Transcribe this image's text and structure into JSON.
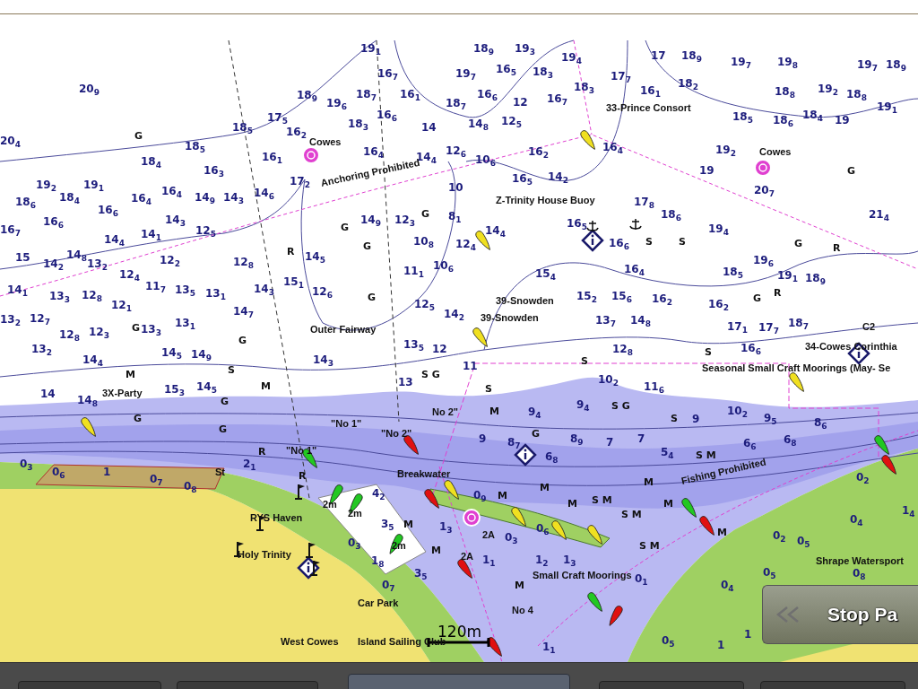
{
  "chart": {
    "place_names": [
      "Cowes",
      "33-Prince Consort",
      "Cowes",
      "Anchoring Prohibited",
      "Z-Trinity House Buoy",
      "39-Snowden",
      "39-Snowden",
      "Outer Fairway",
      "C2",
      "34-Cowes Corinthia",
      "Seasonal Small Craft Moorings (May- Se",
      "3X-Party",
      "No 2\"",
      "\"No 1\"",
      "\"No 2\"",
      "\"No 1\"",
      "St",
      "Breakwater",
      "Fishing Prohibited",
      "2m",
      "2m",
      "2m",
      "RYS Haven",
      "Holy Trinity",
      "2A",
      "2A",
      "Small Craft Moorings",
      "Car Park",
      "No 4",
      "Shrape Watersport",
      "West Cowes",
      "Island Sailing Club"
    ],
    "seabed_codes": [
      "G",
      "G",
      "G",
      "R",
      "G",
      "G",
      "G",
      "G",
      "M",
      "S",
      "S G",
      "M",
      "G",
      "G",
      "S",
      "M",
      "G",
      "R",
      "R",
      "S",
      "S",
      "G",
      "G",
      "R",
      "G",
      "R",
      "S",
      "S",
      "S G",
      "S",
      "S M",
      "G",
      "M",
      "M",
      "S M",
      "S M",
      "S M",
      "M",
      "M",
      "M",
      "M",
      "M",
      "M",
      "M"
    ],
    "soundings": [
      "19$_{1}$",
      "18$_{9}$",
      "19$_{3}$",
      "19$_{4}$",
      "17",
      "18$_{9}$",
      "19$_{7}$",
      "19$_{8}$",
      "19$_{7}$",
      "18$_{9}$",
      "20$_{9}$",
      "16$_{7}$",
      "19$_{7}$",
      "16$_{5}$",
      "18$_{3}$",
      "17$_{7}$",
      "18$_{3}$",
      "16$_{1}$",
      "18$_{2}$",
      "18$_{9}$",
      "19$_{6}$",
      "18$_{7}$",
      "16$_{1}$",
      "18$_{7}$",
      "16$_{6}$",
      "12",
      "16$_{7}$",
      "18$_{5}$",
      "18$_{8}$",
      "18$_{6}$",
      "18$_{4}$",
      "19$_{2}$",
      "18$_{8}$",
      "19",
      "19$_{1}$",
      "17$_{5}$",
      "18$_{3}$",
      "16$_{6}$",
      "14",
      "14$_{8}$",
      "12$_{5}$",
      "16$_{2}$",
      "18$_{5}$",
      "18$_{4}$",
      "20$_{4}$",
      "18$_{5}$",
      "16$_{3}$",
      "16$_{1}$",
      "16$_{4}$",
      "14$_{4}$",
      "12$_{6}$",
      "10$_{6}$",
      "16$_{2}$",
      "16$_{5}$",
      "14$_{2}$",
      "16$_{4}$",
      "19$_{2}$",
      "19",
      "19$_{2}$",
      "19$_{1}$",
      "17$_{2}$",
      "14$_{6}$",
      "10",
      "20$_{7}$",
      "17$_{8}$",
      "18$_{6}$",
      "21$_{4}$",
      "18$_{6}$",
      "18$_{4}$",
      "16$_{6}$",
      "16$_{4}$",
      "16$_{4}$",
      "14$_{9}$",
      "14$_{3}$",
      "16$_{7}$",
      "16$_{6}$",
      "14$_{3}$",
      "12$_{5}$",
      "14$_{9}$",
      "12$_{3}$",
      "8$_{1}$",
      "14$_{4}$",
      "16$_{5}$",
      "16$_{6}$",
      "19$_{4}$",
      "10$_{8}$",
      "12$_{4}$",
      "14$_{8}$",
      "14$_{4}$",
      "14$_{1}$",
      "15",
      "14$_{2}$",
      "13$_{2}$",
      "12$_{2}$",
      "12$_{8}$",
      "14$_{5}$",
      "11$_{1}$",
      "10$_{6}$",
      "15$_{4}$",
      "16$_{4}$",
      "19$_{6}$",
      "18$_{5}$",
      "19$_{1}$",
      "18$_{9}$",
      "14$_{1}$",
      "13$_{3}$",
      "12$_{8}$",
      "12$_{4}$",
      "11$_{7}$",
      "13$_{5}$",
      "13$_{1}$",
      "14$_{3}$",
      "15$_{1}$",
      "12$_{6}$",
      "12$_{5}$",
      "15$_{2}$",
      "15$_{6}$",
      "16$_{2}$",
      "16$_{2}$",
      "13$_{2}$",
      "12$_{7}$",
      "12$_{1}$",
      "14$_{7}$",
      "14$_{2}$",
      "13$_{7}$",
      "14$_{8}$",
      "17$_{1}$",
      "17$_{7}$",
      "18$_{7}$",
      "12$_{8}$",
      "12$_{3}$",
      "13$_{3}$",
      "13$_{1}$",
      "13$_{2}$",
      "14$_{5}$",
      "14$_{9}$",
      "14$_{3}$",
      "13$_{5}$",
      "12",
      "12$_{8}$",
      "16$_{6}$",
      "14$_{4}$",
      "15$_{3}$",
      "14$_{5}$",
      "13",
      "11",
      "10$_{2}$",
      "11$_{6}$",
      "10$_{2}$",
      "9$_{5}$",
      "8$_{6}$",
      "14",
      "14$_{8}$",
      "9$_{4}$",
      "9$_{4}$",
      "9",
      "8$_{7}$",
      "8$_{9}$",
      "7",
      "7",
      "6$_{6}$",
      "6$_{8}$",
      "6$_{8}$",
      "5$_{4}$",
      "2$_{1}$",
      "4$_{2}$",
      "3$_{5}$",
      "0$_{3}$",
      "1$_{8}$",
      "3$_{5}$",
      "0$_{7}$",
      "1$_{3}$",
      "1$_{1}$",
      "1$_{2}$",
      "1$_{3}$",
      "0$_{1}$",
      "0$_{9}$",
      "0$_{3}$",
      "0$_{6}$",
      "0$_{3}$",
      "0$_{6}$",
      "1",
      "0$_{7}$",
      "0$_{8}$",
      "0$_{2}$",
      "0$_{4}$",
      "0$_{2}$",
      "0$_{5}$",
      "0$_{5}$",
      "0$_{4}$",
      "0$_{8}$",
      "1$_{4}$",
      "0$_{5}$",
      "1",
      "1",
      "1$_{1}$",
      "9"
    ],
    "scale": "120m"
  },
  "route_button": {
    "label": "Stop Pa"
  }
}
